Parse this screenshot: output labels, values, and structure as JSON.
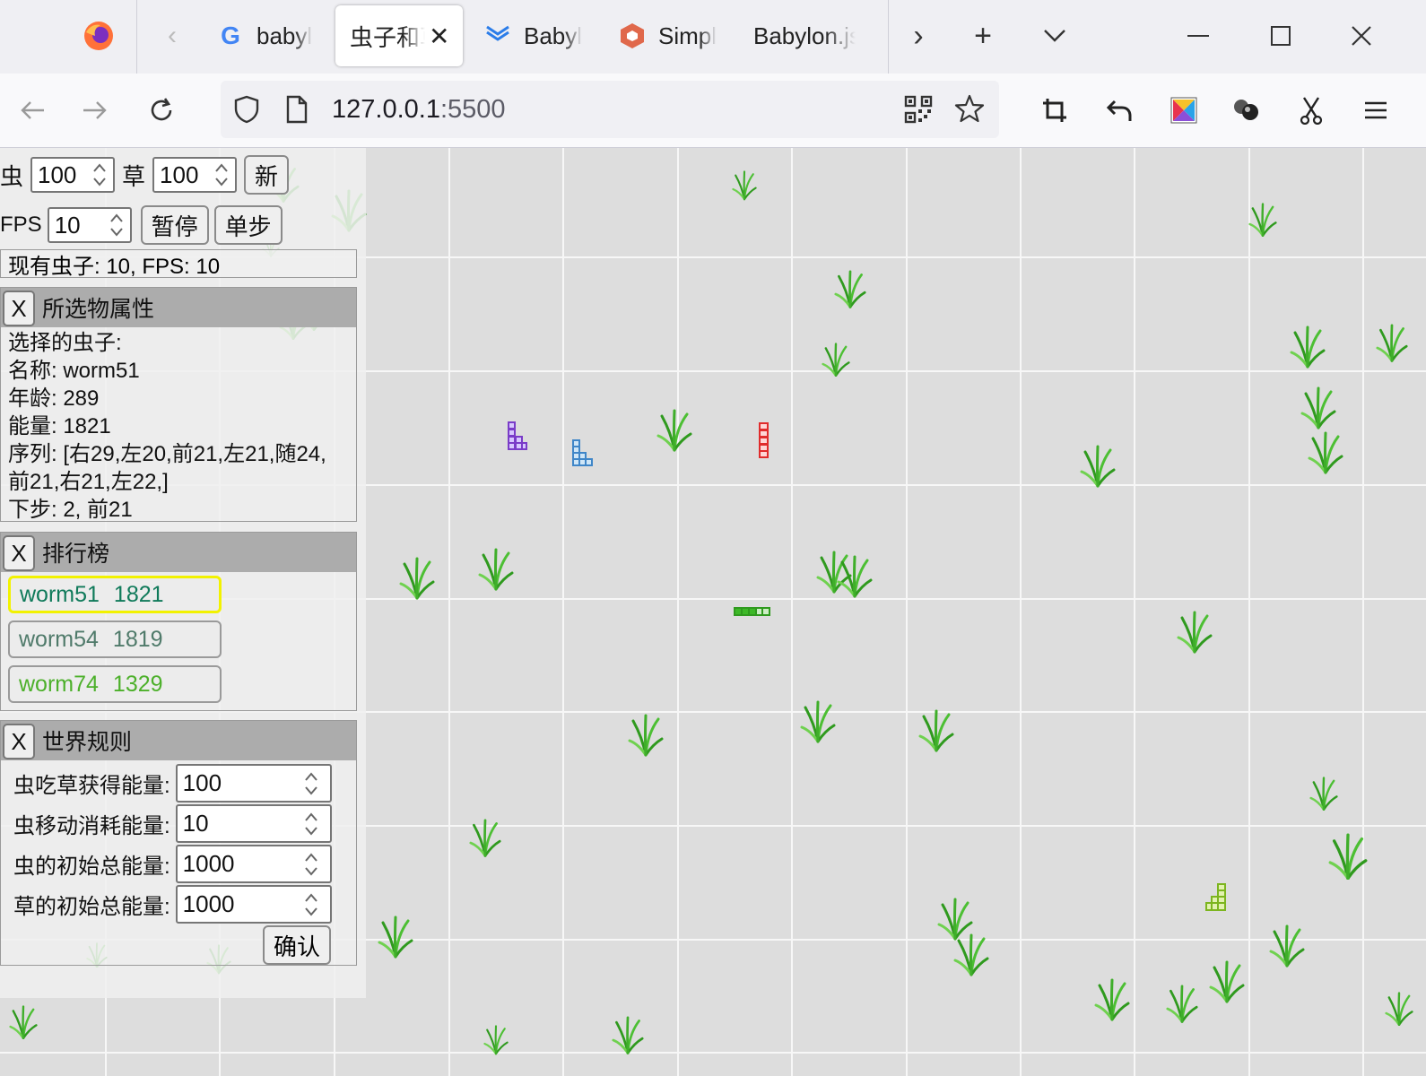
{
  "browser": {
    "tabs": [
      {
        "label": "babyl",
        "icon": "google-icon",
        "active": false
      },
      {
        "label": "虫子和草",
        "icon": "",
        "active": true
      },
      {
        "label": "Babyl",
        "icon": "babylon-docs-icon",
        "active": false
      },
      {
        "label": "Simpl",
        "icon": "babylon-logo-icon",
        "active": false
      },
      {
        "label": "Babylon.js",
        "icon": "",
        "active": false
      }
    ],
    "url_host": "127.0.0.1",
    "url_port": ":5500"
  },
  "controls": {
    "worm_label": "虫",
    "worm_count": "100",
    "grass_label": "草",
    "grass_count": "100",
    "new_button": "新",
    "fps_label": "FPS",
    "fps_value": "10",
    "pause_button": "暂停",
    "step_button": "单步",
    "status": "现有虫子: 10, FPS: 10"
  },
  "selected": {
    "close": "X",
    "title": "所选物属性",
    "lines": [
      "选择的虫子:",
      "名称: worm51",
      "年龄: 289",
      "能量: 1821",
      "序列: [右29,左20,前21,左21,随24,",
      "前21,右21,左22,]",
      "下步: 2, 前21"
    ]
  },
  "leaderboard": {
    "close": "X",
    "title": "排行榜",
    "items": [
      {
        "name": "worm51",
        "energy": "1821",
        "color": "#0f7a5a",
        "selected": true
      },
      {
        "name": "worm54",
        "energy": "1819",
        "color": "#4f7a6a",
        "selected": false
      },
      {
        "name": "worm74",
        "energy": "1329",
        "color": "#4cb02a",
        "selected": false
      }
    ]
  },
  "rules": {
    "close": "X",
    "title": "世界规则",
    "fields": [
      {
        "label": "虫吃草获得能量:",
        "value": "100"
      },
      {
        "label": "虫移动消耗能量:",
        "value": "10"
      },
      {
        "label": "虫的初始总能量:",
        "value": "1000"
      },
      {
        "label": "草的初始总能量:",
        "value": "1000"
      }
    ],
    "confirm": "确认"
  },
  "colors": {
    "highlight_border": "#f2f200",
    "grass": "#3fae2a",
    "grid_line": "#f7f7f7"
  }
}
